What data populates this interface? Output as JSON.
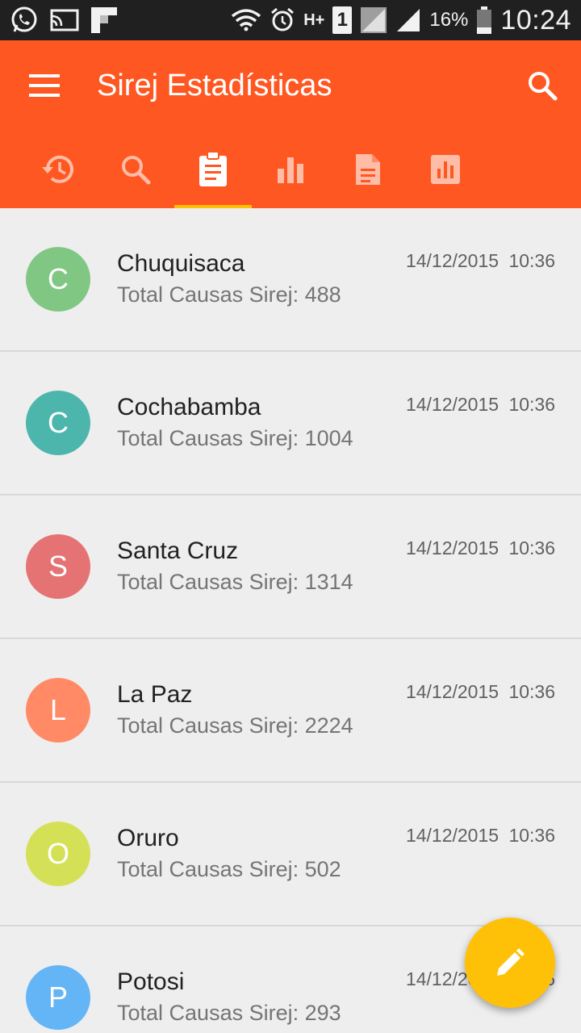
{
  "status_bar": {
    "battery": "16%",
    "time": "10:24",
    "network_type": "H+",
    "sim": "1"
  },
  "app_bar": {
    "title": "Sirej Estadísticas",
    "color": "#ff5722",
    "indicator_color": "#ffc107"
  },
  "tabs": [
    {
      "icon": "history-icon",
      "active": false
    },
    {
      "icon": "search-icon",
      "active": false
    },
    {
      "icon": "clipboard-icon",
      "active": true
    },
    {
      "icon": "bar-chart-icon",
      "active": false
    },
    {
      "icon": "document-icon",
      "active": false
    },
    {
      "icon": "chart-box-icon",
      "active": false
    }
  ],
  "items": [
    {
      "initial": "C",
      "name": "Chuquisaca",
      "subtitle": "Total Causas Sirej: 488",
      "date": "14/12/2015 10:36",
      "color": "#81c784"
    },
    {
      "initial": "C",
      "name": "Cochabamba",
      "subtitle": "Total Causas Sirej: 1004",
      "date": "14/12/2015 10:36",
      "color": "#4db6ac"
    },
    {
      "initial": "S",
      "name": "Santa Cruz",
      "subtitle": "Total Causas Sirej: 1314",
      "date": "14/12/2015 10:36",
      "color": "#e57373"
    },
    {
      "initial": "L",
      "name": "La Paz",
      "subtitle": "Total Causas Sirej: 2224",
      "date": "14/12/2015 10:36",
      "color": "#ff8a65"
    },
    {
      "initial": "O",
      "name": "Oruro",
      "subtitle": "Total Causas Sirej: 502",
      "date": "14/12/2015 10:36",
      "color": "#d4e157"
    },
    {
      "initial": "P",
      "name": "Potosi",
      "subtitle": "Total Causas Sirej: 293",
      "date": "14/12/2015 10:36",
      "color": "#64b5f6"
    }
  ],
  "fab": {
    "icon": "pencil-icon",
    "color": "#ffc107"
  }
}
